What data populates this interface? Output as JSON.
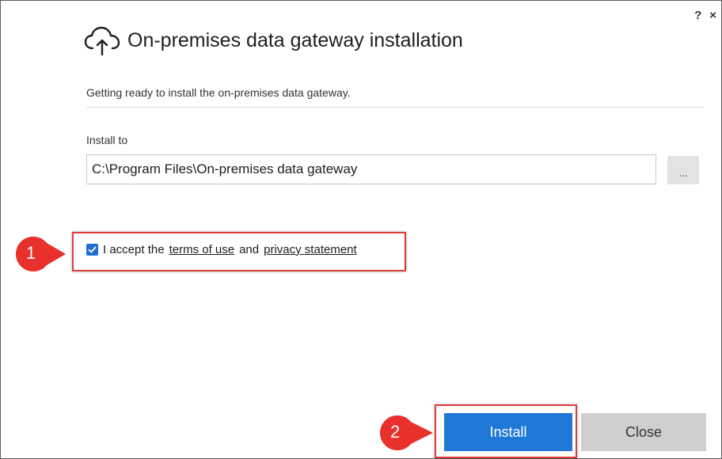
{
  "window": {
    "help_label": "?",
    "close_label": "×"
  },
  "header": {
    "title": "On-premises data gateway installation",
    "icon": "cloud-upload-icon"
  },
  "subtitle": "Getting ready to install the on-premises data gateway.",
  "install_to": {
    "label": "Install to",
    "path": "C:\\Program Files\\On-premises data gateway",
    "browse_label": "..."
  },
  "accept": {
    "checked": true,
    "prefix": "I accept the",
    "terms_link": "terms of use",
    "conjunction": "and",
    "privacy_link": "privacy statement"
  },
  "callouts": {
    "step1": "1",
    "step2": "2"
  },
  "buttons": {
    "install": "Install",
    "close": "Close"
  },
  "colors": {
    "accent": "#1f78d6",
    "highlight": "#e03c3c",
    "close_button": "#cfcfcf"
  }
}
